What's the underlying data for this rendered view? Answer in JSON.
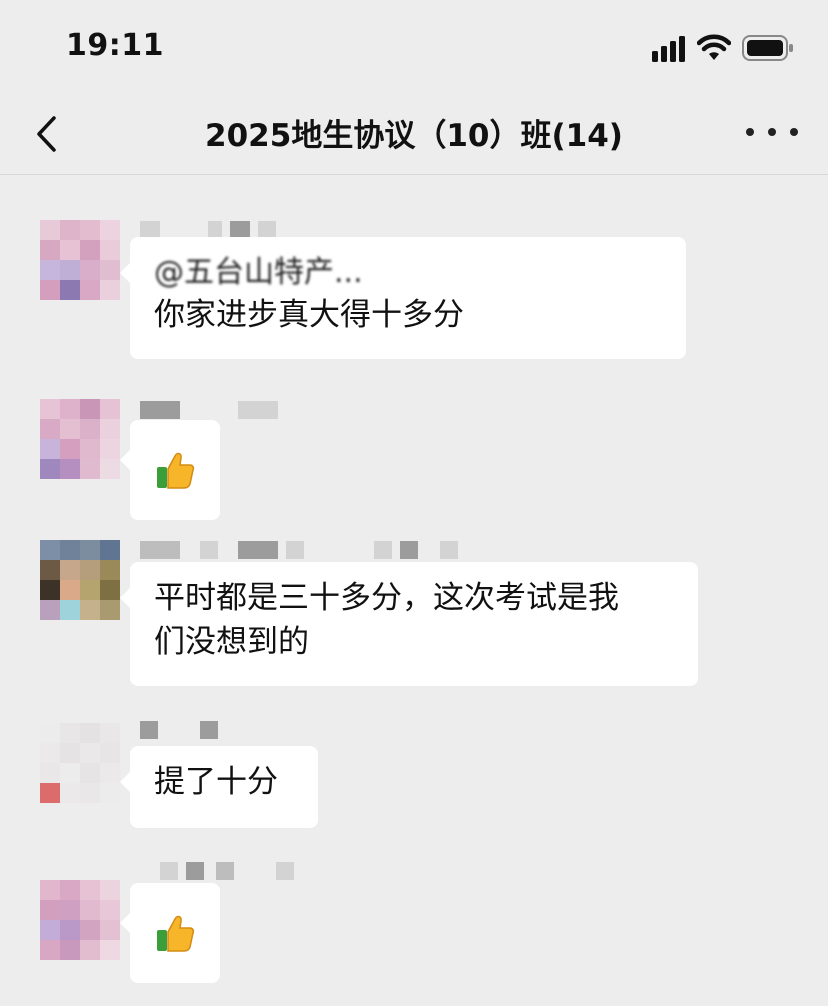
{
  "status_bar": {
    "time": "19:11"
  },
  "nav": {
    "title": "2025地生协议（10）班(14)"
  },
  "messages": [
    {
      "id": "m1",
      "mention": "@五台山特产...",
      "text": "你家进步真大得十多分"
    },
    {
      "id": "m2",
      "emoji": "thumbs-up"
    },
    {
      "id": "m3",
      "text_line1": "平时都是三十多分，这次考试是我",
      "text_line2": "们没想到的"
    },
    {
      "id": "m4",
      "text": "提了十分"
    },
    {
      "id": "m5",
      "emoji": "thumbs-up"
    }
  ],
  "icons": {
    "back": "chevron-left-icon",
    "more": "ellipsis-icon",
    "signal": "cellular-signal-icon",
    "wifi": "wifi-icon",
    "battery": "battery-icon",
    "thumbs_up": "thumbs-up-icon"
  },
  "colors": {
    "background": "#ededed",
    "bubble": "#ffffff",
    "text": "#111111"
  }
}
